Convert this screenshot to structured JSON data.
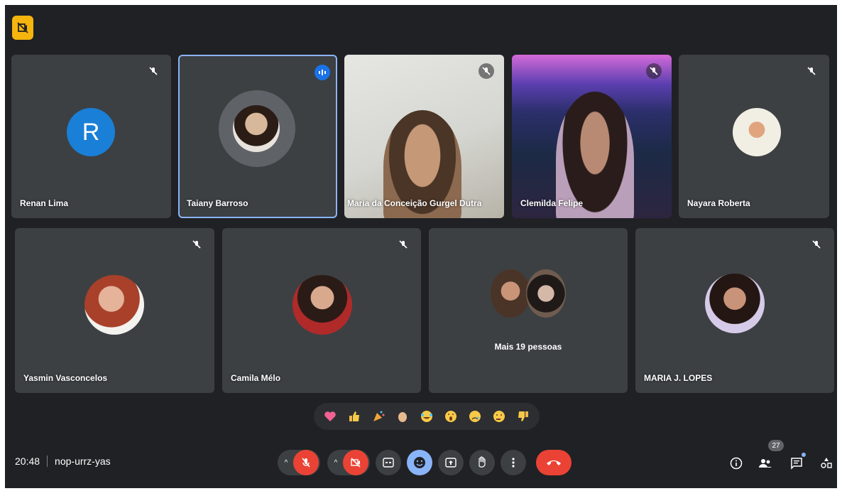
{
  "meeting": {
    "time": "20:48",
    "code": "nop-urrz-yas",
    "participant_count": "27"
  },
  "colors": {
    "background": "#202124",
    "tile": "#3c4043",
    "accent": "#1a73e8",
    "danger": "#ea4335",
    "recording": "#f6b40e"
  },
  "tiles": [
    {
      "name": "Renan Lima",
      "avatar_letter": "R",
      "muted": true
    },
    {
      "name": "Taiany Barroso",
      "muted": false,
      "speaking": true
    },
    {
      "name": "Maria da Conceição Gurgel Dutra",
      "muted": true,
      "video": true
    },
    {
      "name": "Clemilda Felipe",
      "muted": true,
      "video": true
    },
    {
      "name": "Nayara Roberta",
      "muted": true
    },
    {
      "name": "Yasmin Vasconcelos",
      "muted": true
    },
    {
      "name": "Camila Mélo",
      "muted": true
    },
    {
      "name": "Mais 19 pessoas"
    },
    {
      "name": "MARIA J. LOPES",
      "muted": true
    }
  ],
  "reactions": [
    "sparkling-heart",
    "thumbs-up",
    "party-popper",
    "clapping-hands",
    "tears-of-joy",
    "surprised-face",
    "sad-face",
    "thinking-face",
    "thumbs-down"
  ],
  "controls": [
    "mic-off-icon",
    "camera-off-icon",
    "captions-icon",
    "reactions-icon",
    "present-icon",
    "raise-hand-icon",
    "more-options-icon",
    "leave-call-icon"
  ],
  "side_controls": [
    "info-icon",
    "people-icon",
    "chat-icon",
    "activities-icon"
  ]
}
